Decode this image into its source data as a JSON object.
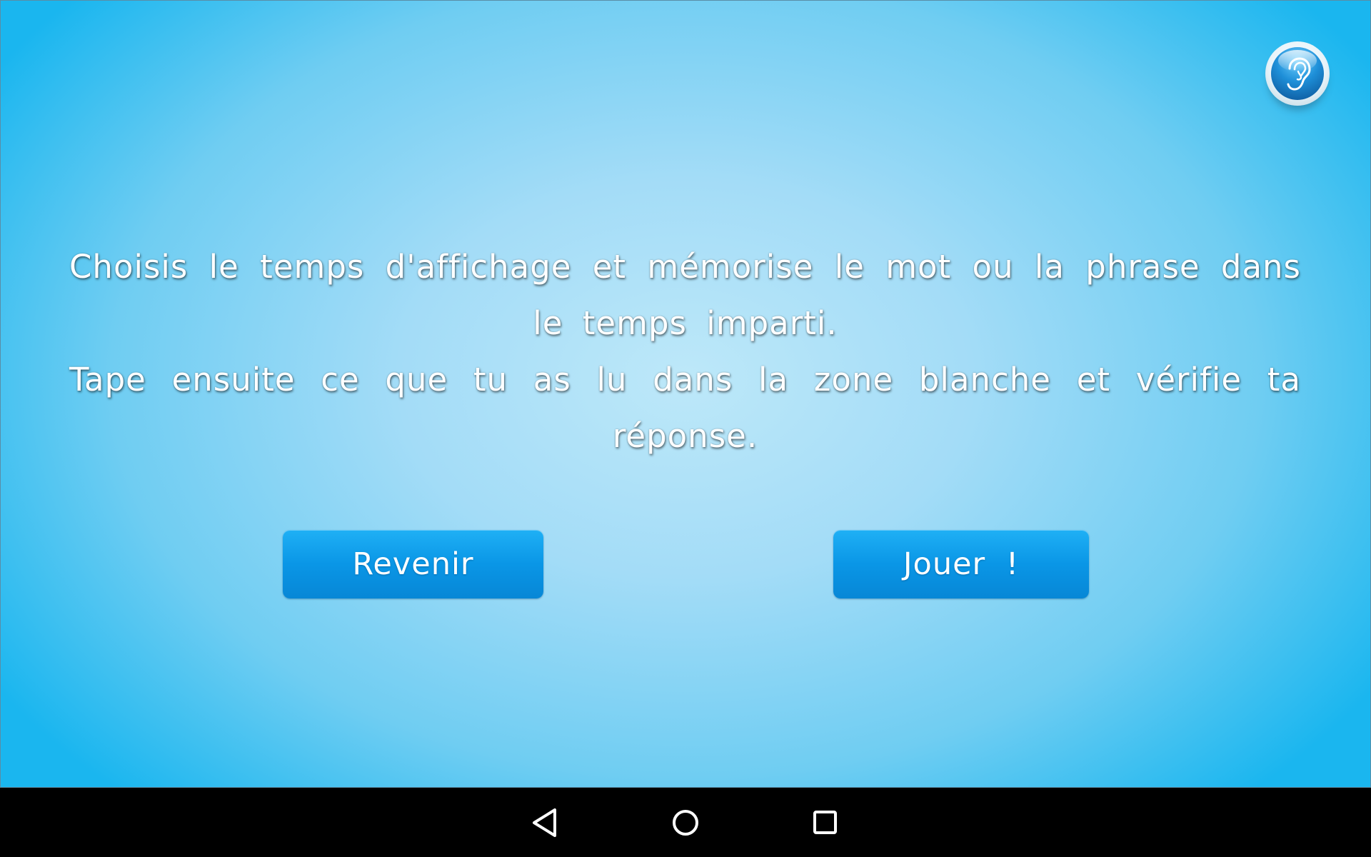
{
  "app": {
    "instructions": {
      "paragraph1": "Choisis le temps d'affichage et mémorise le mot ou la phrase dans le temps imparti.",
      "paragraph2": "Tape ensuite ce que tu as lu dans la zone blanche et vérifie ta réponse."
    },
    "buttons": {
      "back_label": "Revenir",
      "play_label": "Jouer !"
    },
    "audio_button": {
      "icon": "ear-icon"
    }
  },
  "navbar": {
    "icons": [
      "back-triangle-icon",
      "home-circle-icon",
      "recents-square-icon"
    ]
  },
  "colors": {
    "background_center": "#bde8f9",
    "background_edge": "#1ab6ef",
    "button": "#0a96e6",
    "text": "#ffffff",
    "navbar": "#000000"
  }
}
